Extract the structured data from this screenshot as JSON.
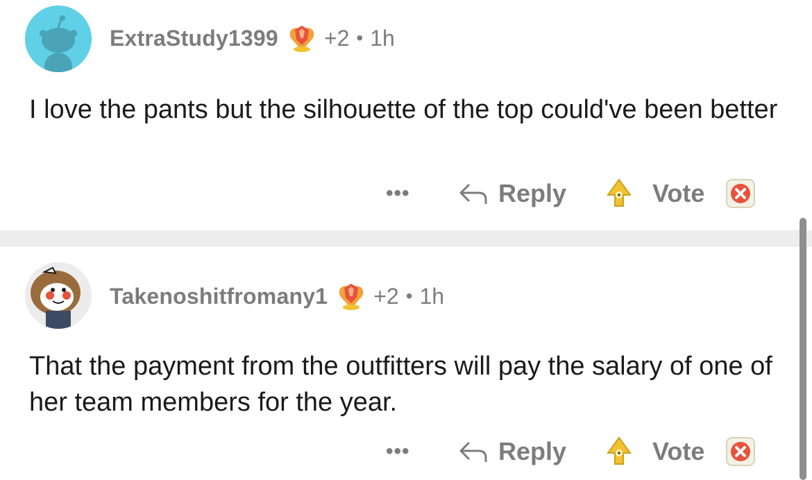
{
  "comments": [
    {
      "username": "ExtraStudy1399",
      "award_count": "+2",
      "separator": "•",
      "age": "1h",
      "body": "I love the pants but the silhouette of the top could've been better",
      "actions": {
        "more": "•••",
        "reply": "Reply",
        "vote": "Vote"
      }
    },
    {
      "username": "Takenoshitfromany1",
      "award_count": "+2",
      "separator": "•",
      "age": "1h",
      "body": "That the payment from the outfitters will pay the salary of one of her team members for the year.",
      "actions": {
        "more": "•••",
        "reply": "Reply",
        "vote": "Vote"
      }
    }
  ],
  "icons": {
    "avatar_1": "snoo-avatar-icon",
    "avatar_2": "owl-avatar-icon",
    "award": "crystal-heart-award-icon",
    "reply": "reply-arrow-icon",
    "upvote": "gold-upvote-icon",
    "downvote": "red-x-downvote-icon"
  },
  "colors": {
    "meta_text": "#7c7c7c",
    "body_text": "#1a1a1b",
    "avatar_1_bg": "#5fd0e6",
    "divider": "#ededed",
    "downvote": "#e8523a",
    "upvote": "#f2c230"
  }
}
